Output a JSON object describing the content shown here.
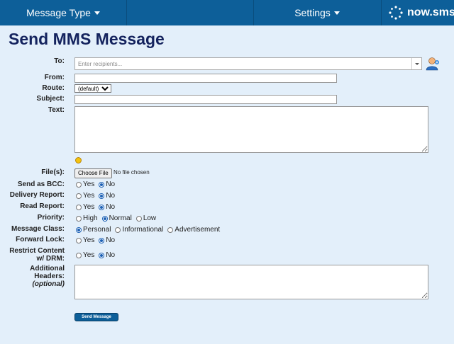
{
  "nav": {
    "message_type": "Message Type",
    "settings": "Settings",
    "logo_text": "now.sms"
  },
  "page_title": "Send MMS Message",
  "labels": {
    "to": "To:",
    "from": "From:",
    "route": "Route:",
    "subject": "Subject:",
    "text": "Text:",
    "files": "File(s):",
    "send_as_bcc": "Send as BCC:",
    "delivery_report": "Delivery Report:",
    "read_report": "Read Report:",
    "priority": "Priority:",
    "message_class": "Message Class:",
    "forward_lock": "Forward Lock:",
    "restrict_line1": "Restrict Content",
    "restrict_line2": "w/ DRM:",
    "additional_line1": "Additional",
    "additional_line2": "Headers:",
    "additional_line3": "(optional)"
  },
  "to": {
    "placeholder": "Enter recipients..."
  },
  "route": {
    "selected": "(default)"
  },
  "file": {
    "button": "Choose File",
    "status": "No file chosen"
  },
  "options": {
    "yes": "Yes",
    "no": "No",
    "priority": [
      "High",
      "Normal",
      "Low"
    ],
    "message_class": [
      "Personal",
      "Informational",
      "Advertisement"
    ]
  },
  "selected": {
    "send_as_bcc": "No",
    "delivery_report": "No",
    "read_report": "No",
    "priority": "Normal",
    "message_class": "Personal",
    "forward_lock": "No",
    "restrict_content": "No"
  },
  "send_button": "Send Message",
  "colors": {
    "nav_bg": "#0d5f99",
    "page_bg": "#e3effa",
    "title": "#14235e",
    "accent": "#1a5fb4"
  }
}
